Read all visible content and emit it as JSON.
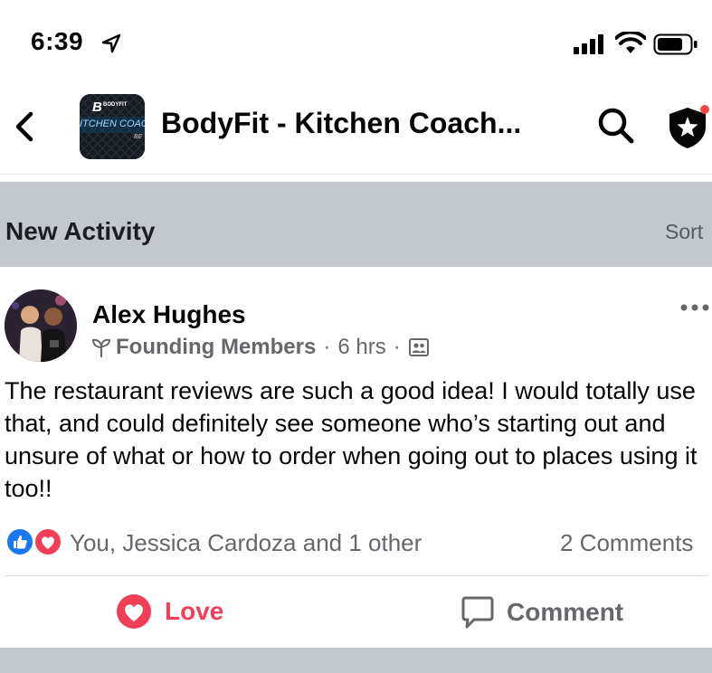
{
  "status_bar": {
    "time": "6:39"
  },
  "header": {
    "title": "BodyFit - Kitchen Coach...",
    "thumbnail_text_top": "BODYFIT",
    "thumbnail_text_mid": "ITCHEN COAC",
    "thumbnail_text_bot": "BE"
  },
  "section": {
    "title": "New Activity",
    "sort_label": "Sort"
  },
  "post": {
    "author": "Alex Hughes",
    "group": "Founding Members",
    "time": "6 hrs",
    "separator": "·",
    "text": "The restaurant reviews are such a good idea! I would totally use that, and could definitely see someone who’s starting out and unsure of what or how to order when going out to places using it too!!",
    "reactors": "You, Jessica Cardoza and 1 other",
    "comments": "2 Comments"
  },
  "actions": {
    "love_label": "Love",
    "comment_label": "Comment"
  },
  "colors": {
    "love": "#f33e58",
    "like": "#1877f2",
    "band": "#c3c7ce",
    "notification": "#f0494a"
  }
}
